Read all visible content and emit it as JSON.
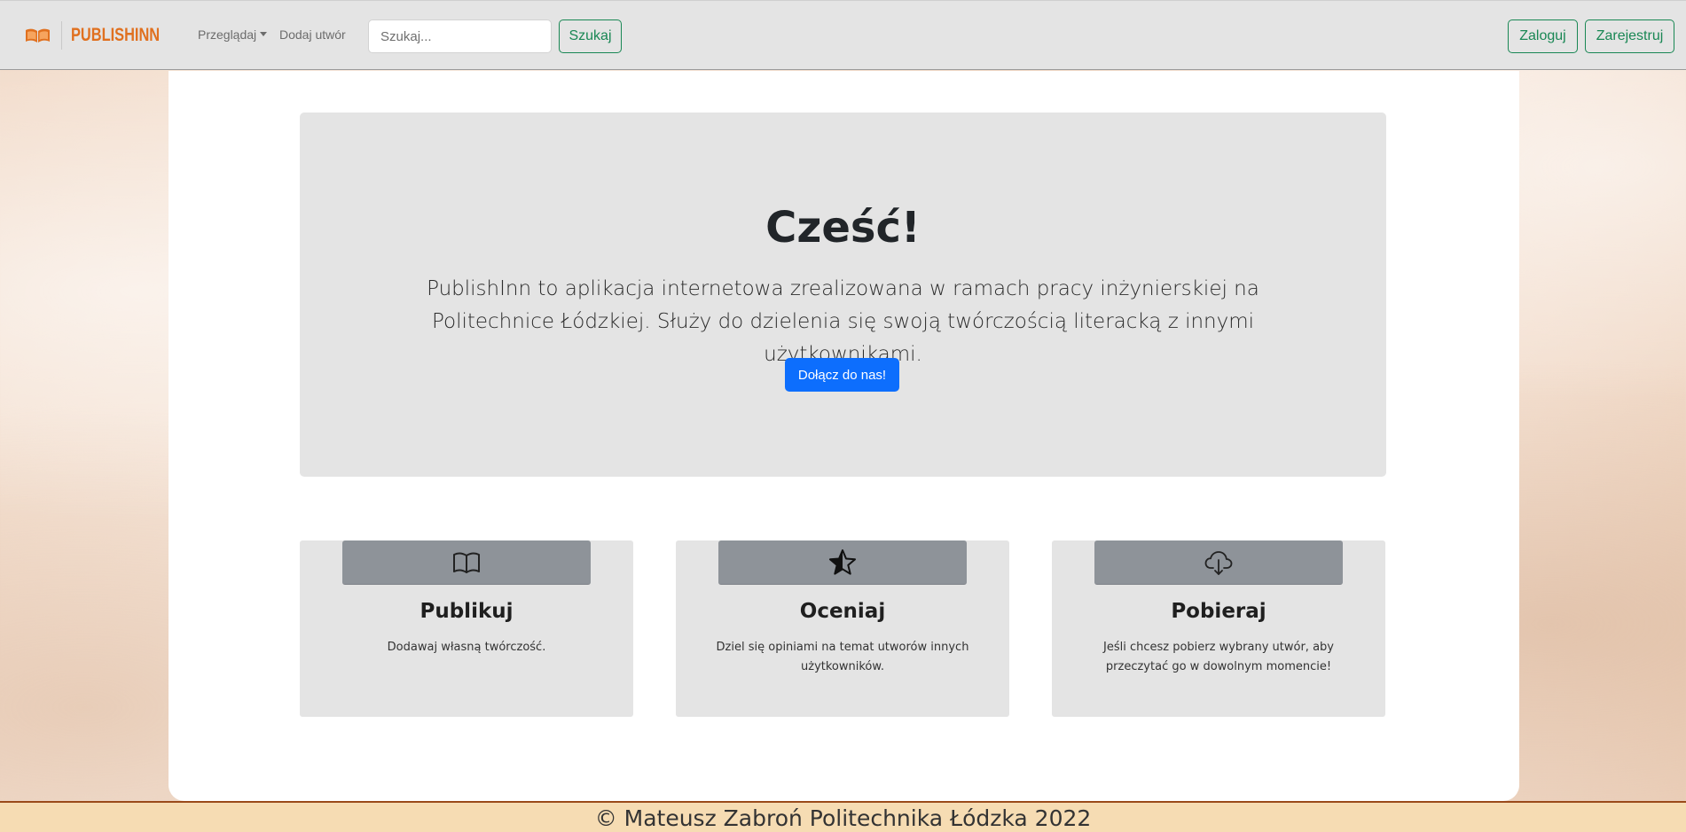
{
  "navbar": {
    "brand": "PUBLISHINN",
    "browse_label": "Przeglądaj",
    "add_work_label": "Dodaj utwór",
    "search_placeholder": "Szukaj...",
    "search_button": "Szukaj",
    "login_button": "Zaloguj",
    "register_button": "Zarejestruj"
  },
  "hero": {
    "title": "Cześć!",
    "text": "PublishInn to aplikacja internetowa zrealizowana w ramach pracy inżynierskiej na Politechnice Łódzkiej. Służy do dzielenia się swoją twórczością literacką z innymi użytkownikami.",
    "cta": "Dołącz do nas!"
  },
  "features": [
    {
      "icon": "book-icon",
      "title": "Publikuj",
      "description": "Dodawaj własną twórczość."
    },
    {
      "icon": "star-icon",
      "title": "Oceniaj",
      "description": "Dziel się opiniami na temat utworów innych użytkowników."
    },
    {
      "icon": "cloud-download-icon",
      "title": "Pobieraj",
      "description": "Jeśli chcesz pobierz wybrany utwór, aby przeczytać go w dowolnym momencie!"
    }
  ],
  "footer": {
    "text": "© Mateusz Zabroń Politechnika Łódzka 2022"
  },
  "colors": {
    "brand": "#e0701f",
    "success_outline": "#198754",
    "primary": "#0d6efd",
    "footer_bg": "#f6dcb3",
    "footer_border": "#9a4a1a"
  }
}
